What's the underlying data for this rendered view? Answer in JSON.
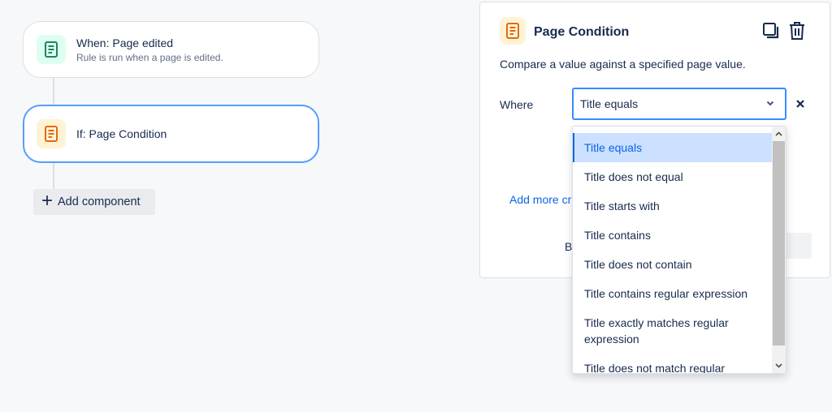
{
  "flow": {
    "trigger": {
      "title": "When: Page edited",
      "subtitle": "Rule is run when a page is edited."
    },
    "condition": {
      "title": "If: Page Condition"
    },
    "add_component_label": "Add component"
  },
  "panel": {
    "title": "Page Condition",
    "description": "Compare a value against a specified page value.",
    "where_label": "Where",
    "selected_value": "Title equals",
    "add_more_label": "Add more cr",
    "truncated_button_letter": "B"
  },
  "dropdown": {
    "options": [
      "Title equals",
      "Title does not equal",
      "Title starts with",
      "Title contains",
      "Title does not contain",
      "Title contains regular expression",
      "Title exactly matches regular expression",
      "Title does not match regular expression"
    ],
    "active_index": 0
  },
  "colors": {
    "accent": "#0c66e4",
    "trigger_icon": "#1f845a",
    "condition_icon": "#e56910"
  }
}
